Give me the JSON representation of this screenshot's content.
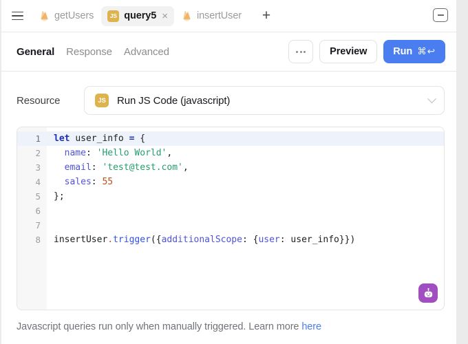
{
  "tabbar": {
    "menu_icon": "hamburger-icon",
    "minimize_icon": "minimize-icon",
    "add_tab_label": "+",
    "tabs": [
      {
        "label": "getUsers",
        "icon": "firebase-flame-icon",
        "active": false,
        "closable": false
      },
      {
        "label": "query5",
        "icon": "js-badge-icon",
        "badge": "JS",
        "active": true,
        "closable": true,
        "close_label": "×"
      },
      {
        "label": "insertUser",
        "icon": "firebase-flame-icon",
        "active": false,
        "closable": false
      }
    ]
  },
  "toolbar": {
    "subtabs": [
      {
        "label": "General",
        "active": true
      },
      {
        "label": "Response",
        "active": false
      },
      {
        "label": "Advanced",
        "active": false
      }
    ],
    "more_label": "…",
    "preview_label": "Preview",
    "run_label": "Run",
    "run_shortcut": "⌘↩"
  },
  "resource": {
    "label": "Resource",
    "badge": "JS",
    "value": "Run JS Code (javascript)",
    "chevron": "chevron-down-icon"
  },
  "editor": {
    "active_line": 1,
    "fold_marker": "∨",
    "assistant_icon": "robot-icon",
    "lines": [
      {
        "num": "1",
        "fold": true,
        "tokens": [
          {
            "t": "let ",
            "c": "k-let"
          },
          {
            "t": "user_info ",
            "c": "k-plain"
          },
          {
            "t": "= ",
            "c": "k-let"
          },
          {
            "t": "{",
            "c": "k-punc"
          }
        ]
      },
      {
        "num": "2",
        "fold": false,
        "tokens": [
          {
            "t": "  ",
            "c": "k-plain"
          },
          {
            "t": "name",
            "c": "k-prop"
          },
          {
            "t": ": ",
            "c": "k-punc"
          },
          {
            "t": "'Hello World'",
            "c": "k-str"
          },
          {
            "t": ",",
            "c": "k-punc"
          }
        ]
      },
      {
        "num": "3",
        "fold": false,
        "tokens": [
          {
            "t": "  ",
            "c": "k-plain"
          },
          {
            "t": "email",
            "c": "k-prop"
          },
          {
            "t": ": ",
            "c": "k-punc"
          },
          {
            "t": "'test@test.com'",
            "c": "k-str"
          },
          {
            "t": ",",
            "c": "k-punc"
          }
        ]
      },
      {
        "num": "4",
        "fold": false,
        "tokens": [
          {
            "t": "  ",
            "c": "k-plain"
          },
          {
            "t": "sales",
            "c": "k-prop"
          },
          {
            "t": ": ",
            "c": "k-punc"
          },
          {
            "t": "55",
            "c": "k-num"
          }
        ]
      },
      {
        "num": "5",
        "fold": false,
        "tokens": [
          {
            "t": "};",
            "c": "k-punc"
          }
        ]
      },
      {
        "num": "6",
        "fold": false,
        "tokens": []
      },
      {
        "num": "7",
        "fold": false,
        "tokens": []
      },
      {
        "num": "8",
        "fold": false,
        "tokens": [
          {
            "t": "insertUser",
            "c": "k-plain"
          },
          {
            "t": ".",
            "c": "k-dot"
          },
          {
            "t": "trigger",
            "c": "k-fn"
          },
          {
            "t": "({",
            "c": "k-punc"
          },
          {
            "t": "additionalScope",
            "c": "k-prop"
          },
          {
            "t": ": {",
            "c": "k-punc"
          },
          {
            "t": "user",
            "c": "k-prop"
          },
          {
            "t": ": user_info}})",
            "c": "k-punc"
          }
        ]
      }
    ]
  },
  "footer": {
    "text": "Javascript queries run only when manually triggered. Learn more ",
    "link_label": "here"
  },
  "colors": {
    "accent": "#4a7df0",
    "js_badge": "#ddb34e",
    "assistant": "#a14fc0",
    "active_line": "#eef3fb",
    "string": "#22a06b",
    "number": "#b5521e",
    "property": "#4f53d6",
    "keyword": "#1d2fb5"
  }
}
